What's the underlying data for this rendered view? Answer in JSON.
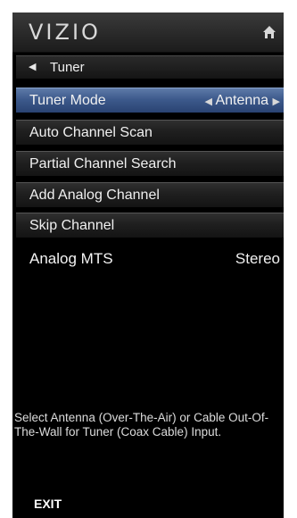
{
  "header": {
    "logo": "VIZIO",
    "home_icon": "home-icon"
  },
  "breadcrumb": {
    "back_icon": "left-triangle-icon",
    "title": "Tuner"
  },
  "menu": {
    "items": [
      {
        "label": "Tuner Mode",
        "value": "Antenna",
        "selected": true
      },
      {
        "label": "Auto Channel Scan"
      },
      {
        "label": "Partial Channel Search"
      },
      {
        "label": "Add Analog Channel"
      },
      {
        "label": "Skip Channel"
      }
    ],
    "analog_mts": {
      "label": "Analog MTS",
      "value": "Stereo"
    }
  },
  "help_text": "Select Antenna (Over-The-Air) or Cable Out-Of-The-Wall for Tuner (Coax Cable) Input.",
  "footer": {
    "exit_label": "EXIT"
  },
  "colors": {
    "background": "#000000",
    "selected_item": "#3d5a8c",
    "text": "#f0f0f0"
  }
}
